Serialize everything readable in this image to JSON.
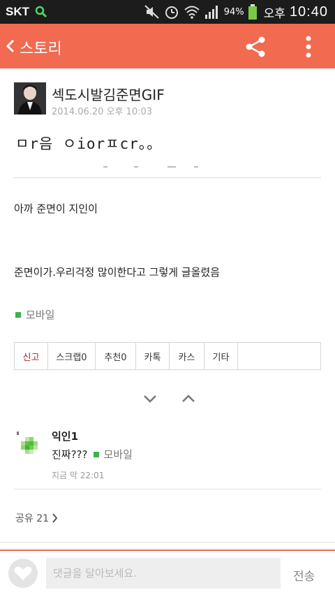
{
  "status_bar": {
    "carrier": "SKT",
    "battery": "94%",
    "ampm": "오후",
    "time": "10:40"
  },
  "app_bar": {
    "title": "스토리"
  },
  "post": {
    "title": "섹도시발김준면GIF",
    "timestamp": "2014.06.20 오후 10:03",
    "handwritten_line": "ㅁr음 ㅇiorㅍcr。。",
    "paragraph_1": "아까 준면이 지인이",
    "paragraph_2": "준면이가.우리걱정 많이한다고 그렇게 글올렸음",
    "device": "모바일"
  },
  "actions": [
    {
      "label": "신고"
    },
    {
      "label": "스크랩0"
    },
    {
      "label": "추천0"
    },
    {
      "label": "카톡"
    },
    {
      "label": "카스"
    },
    {
      "label": "기타"
    }
  ],
  "comment": {
    "author": "익인1",
    "text": "진짜???",
    "device": "모바일",
    "time": "지금 막 22:01"
  },
  "share": {
    "label": "공유 21"
  },
  "input_bar": {
    "placeholder": "댓글을 달아보세요.",
    "send_label": "전송"
  },
  "colors": {
    "accent": "#f26a4f",
    "mobile_dot": "#3bb34a",
    "report": "#b02222"
  }
}
